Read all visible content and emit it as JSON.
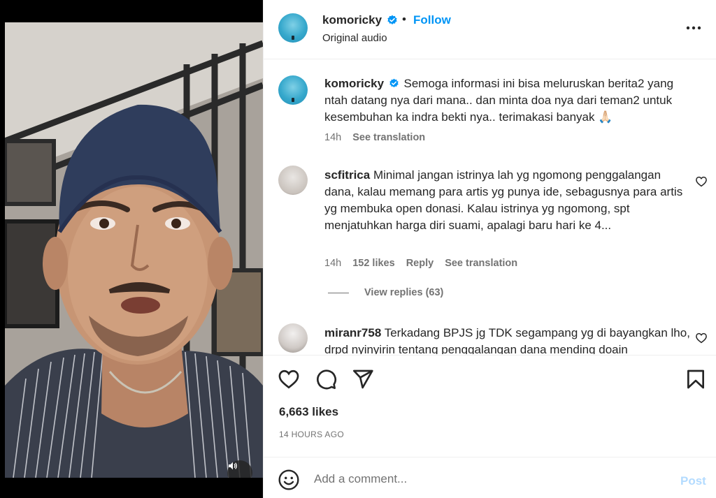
{
  "post": {
    "username": "komoricky",
    "verified": true,
    "follow_label": "Follow",
    "separator": "•",
    "audio": "Original audio",
    "more_icon": "more-horizontal-icon"
  },
  "caption": {
    "username": "komoricky",
    "text": "Semoga informasi ini bisa meluruskan berita2 yang ntah datang nya dari mana.. dan minta doa nya dari teman2 untuk kesembuhan ka indra bekti nya.. terimakasi banyak 🙏🏻",
    "time": "14h",
    "see_translation": "See translation"
  },
  "comments": [
    {
      "username": "scfitrica",
      "text": "Minimal jangan istrinya lah yg ngomong penggalangan dana, kalau memang para artis yg punya ide, sebagusnya para artis yg membuka open donasi. Kalau istrinya yg ngomong, spt menjatuhkan harga diri suami, apalagi baru hari ke 4...",
      "time": "14h",
      "likes": "152 likes",
      "reply": "Reply",
      "see_translation": "See translation",
      "view_replies": "View replies (63)"
    },
    {
      "username": "miranr758",
      "text": "Terkadang BPJS jg TDK segampang yg di bayangkan lho, drpd nyinyirin tentang penggalangan dana mending doain"
    }
  ],
  "actions": {
    "like_icon": "heart-icon",
    "comment_icon": "comment-icon",
    "share_icon": "send-icon",
    "save_icon": "bookmark-icon"
  },
  "likes": "6,663 likes",
  "time_ago": "14 HOURS AGO",
  "add_comment": {
    "placeholder": "Add a comment...",
    "post_label": "Post",
    "emoji_icon": "emoji-icon"
  },
  "media": {
    "sound_icon": "speaker-icon"
  },
  "colors": {
    "accent": "#0095f6",
    "post_disabled": "#b3dbff",
    "meta_text": "#737373",
    "verified": "#0095f6"
  }
}
